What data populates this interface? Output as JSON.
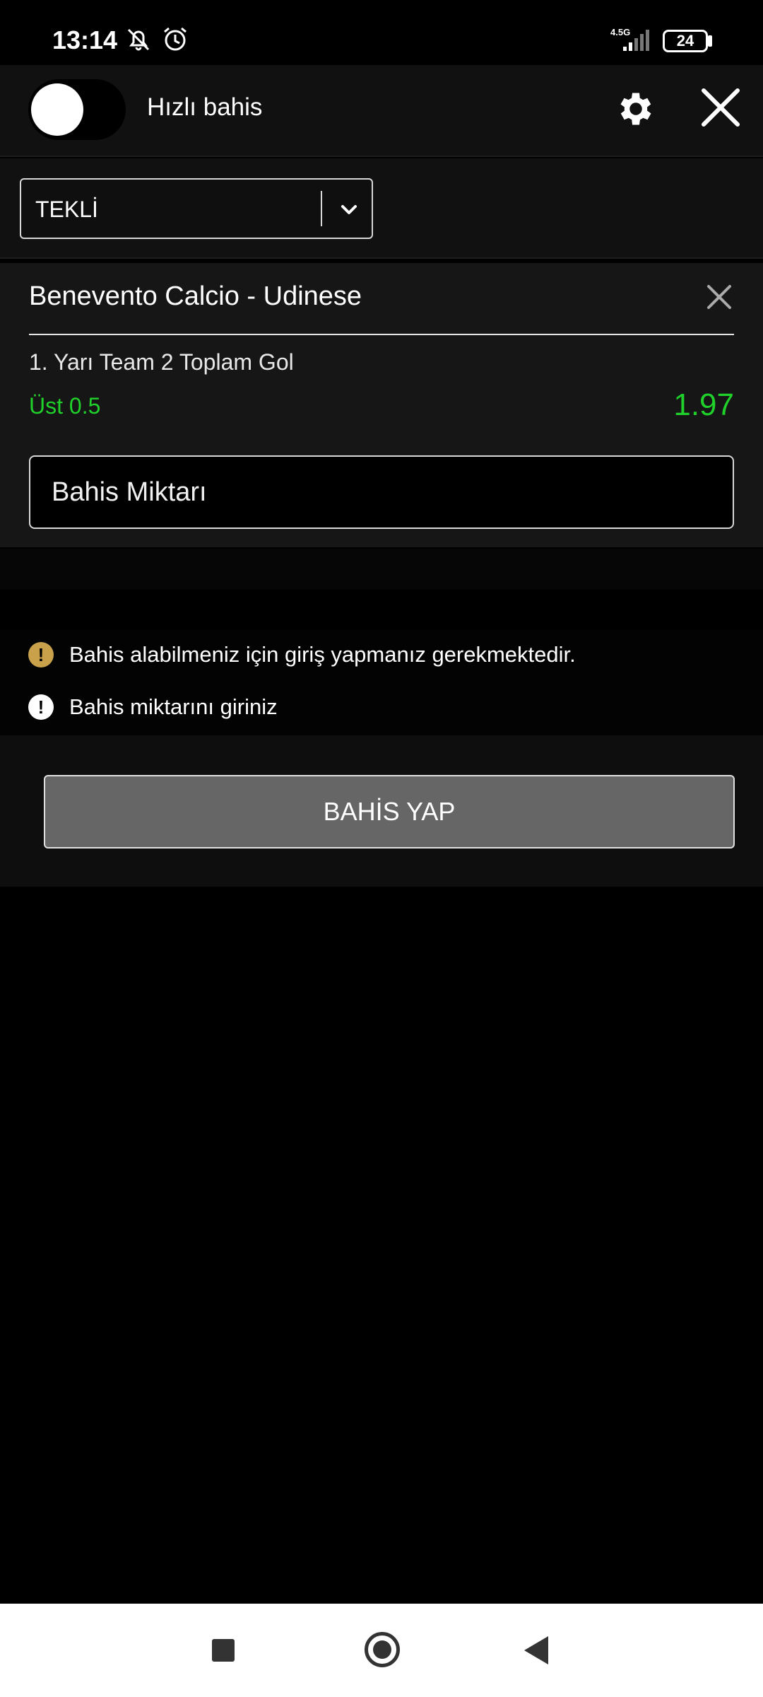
{
  "status_bar": {
    "time": "13:14",
    "network": "4.5G",
    "battery": "24"
  },
  "header": {
    "quick_bet_label": "Hızlı bahis",
    "quick_bet_enabled": false
  },
  "bet_type": {
    "selected": "TEKLİ"
  },
  "bet_slip": {
    "match": "Benevento Calcio - Udinese",
    "market": "1. Yarı Team 2 Toplam Gol",
    "selection": "Üst 0.5",
    "odds": "1.97",
    "stake_placeholder": "Bahis Miktarı"
  },
  "messages": [
    {
      "text": "Bahis alabilmeniz için giriş yapmanız gerekmektedir.",
      "icon": "warning-icon",
      "color": "#c9a14a"
    },
    {
      "text": "Bahis miktarını giriniz",
      "icon": "alert-icon",
      "color": "#ffffff"
    }
  ],
  "actions": {
    "place_bet_label": "BAHİS YAP"
  },
  "colors": {
    "odds_green": "#1fd12a",
    "button_gray": "#666666"
  }
}
